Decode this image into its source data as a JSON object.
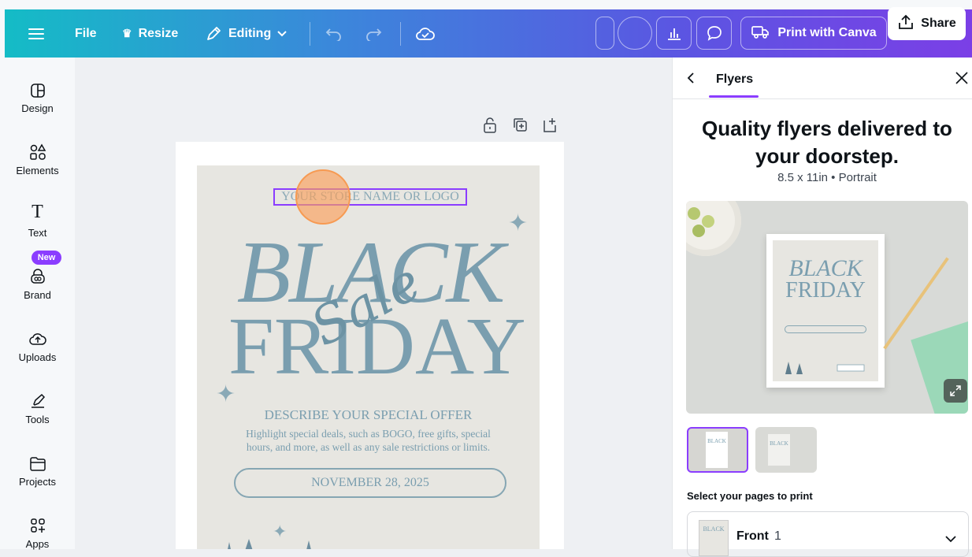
{
  "topbar": {
    "file": "File",
    "resize": "Resize",
    "editing": "Editing",
    "print": "Print with Canva",
    "share": "Share"
  },
  "sidebar": {
    "items": [
      {
        "label": "Design"
      },
      {
        "label": "Elements"
      },
      {
        "label": "Text"
      },
      {
        "label": "Brand"
      },
      {
        "label": "Uploads"
      },
      {
        "label": "Tools"
      },
      {
        "label": "Projects"
      },
      {
        "label": "Apps"
      }
    ],
    "new_badge": "New"
  },
  "flyer": {
    "store": "YOUR STORE NAME OR LOGO",
    "black": "BLACK",
    "friday": "FRIDAY",
    "sale": "Sale",
    "offer": "DESCRIBE YOUR SPECIAL OFFER",
    "desc1": "Highlight special deals, such as BOGO, free gifts, special",
    "desc2": "hours, and more, as well as any sale restrictions or limits.",
    "date": "NOVEMBER 28, 2025"
  },
  "panel": {
    "tab": "Flyers",
    "headline1": "Quality flyers delivered to",
    "headline2": "your doorstep.",
    "spec": "8.5 x 11in • Portrait",
    "select_label": "Select your pages to print",
    "page_name": "Front",
    "page_count": "1"
  },
  "colors": {
    "accent": "#8b3dff",
    "flyer_text": "#7a9eaf",
    "flyer_bg": "#e7e6e1"
  }
}
